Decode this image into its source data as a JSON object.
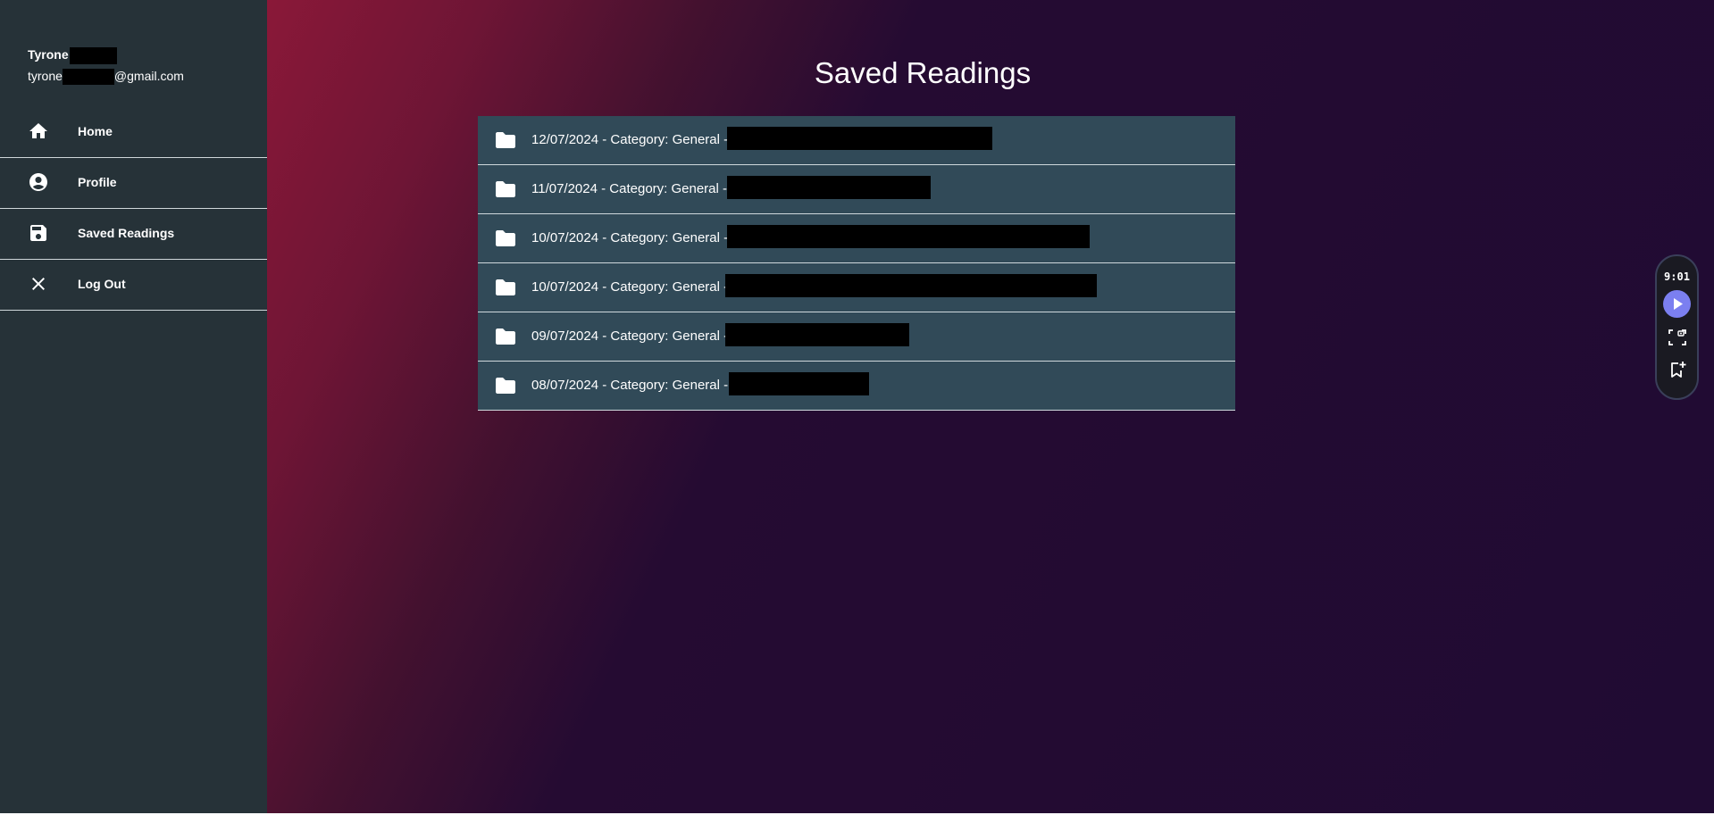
{
  "user": {
    "first_name": "Tyrone",
    "email_prefix": "tyrone",
    "email_suffix": "@gmail.com"
  },
  "nav": {
    "items": [
      {
        "label": "Home",
        "icon": "home-icon"
      },
      {
        "label": "Profile",
        "icon": "account-circle-icon"
      },
      {
        "label": "Saved Readings",
        "icon": "save-icon"
      },
      {
        "label": "Log Out",
        "icon": "close-icon"
      }
    ]
  },
  "main": {
    "title": "Saved Readings",
    "readings": [
      {
        "label": "12/07/2024 - Category: General -",
        "icon": "folder-icon"
      },
      {
        "label": "11/07/2024 - Category: General -",
        "icon": "folder-icon"
      },
      {
        "label": "10/07/2024 - Category: General -",
        "icon": "folder-icon"
      },
      {
        "label": "10/07/2024 - Category: General -",
        "icon": "folder-icon"
      },
      {
        "label": "09/07/2024 - Category: General -",
        "icon": "folder-icon"
      },
      {
        "label": "08/07/2024 - Category: General -",
        "icon": "folder-icon"
      }
    ]
  },
  "widget": {
    "time": "9:01"
  },
  "colors": {
    "sidebar_bg": "#263238",
    "list_item_bg": "#314a58",
    "gradient_start": "#8a1838",
    "gradient_end": "#200b33",
    "play_button": "#7b7ff0"
  }
}
